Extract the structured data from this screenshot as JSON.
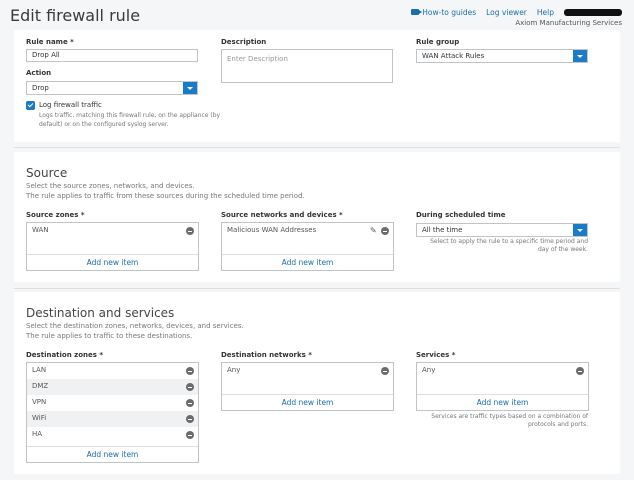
{
  "page": {
    "title": "Edit firewall rule"
  },
  "header": {
    "links": [
      "How-to guides",
      "Log viewer",
      "Help"
    ],
    "org": "Axiom Manufacturing Services"
  },
  "rule": {
    "name_label": "Rule name *",
    "name_value": "Drop All",
    "description_label": "Description",
    "description_placeholder": "Enter Description",
    "group_label": "Rule group",
    "group_value": "WAN Attack Rules",
    "action_label": "Action",
    "action_value": "Drop",
    "log_label": "Log firewall traffic",
    "log_checked": true,
    "log_help_1": "Logs traffic, matching this firewall rule, on the appliance (by",
    "log_help_2": "default) or on the configured syslog server."
  },
  "source": {
    "title": "Source",
    "desc_1": "Select the source zones, networks, and devices.",
    "desc_2": "The rule applies to traffic from these sources during the scheduled time period.",
    "zones_label": "Source zones *",
    "zones": [
      "WAN"
    ],
    "networks_label": "Source networks and devices *",
    "networks": [
      "Malicious WAN Addresses"
    ],
    "schedule_label": "During scheduled time",
    "schedule_value": "All the time",
    "schedule_help_1": "Select to apply the rule to a specific time period and",
    "schedule_help_2": "day of the week.",
    "add_label": "Add new item"
  },
  "destination": {
    "title": "Destination and services",
    "desc_1": "Select the destination zones, networks, devices, and services.",
    "desc_2": "The rule applies to traffic to these destinations.",
    "zones_label": "Destination zones *",
    "zones": [
      "LAN",
      "DMZ",
      "VPN",
      "WiFi",
      "HA"
    ],
    "networks_label": "Destination networks *",
    "networks": [
      "Any"
    ],
    "services_label": "Services *",
    "services": [
      "Any"
    ],
    "services_help_1": "Services are traffic types based on a combination of",
    "services_help_2": "protocols and ports.",
    "add_label": "Add new item"
  }
}
